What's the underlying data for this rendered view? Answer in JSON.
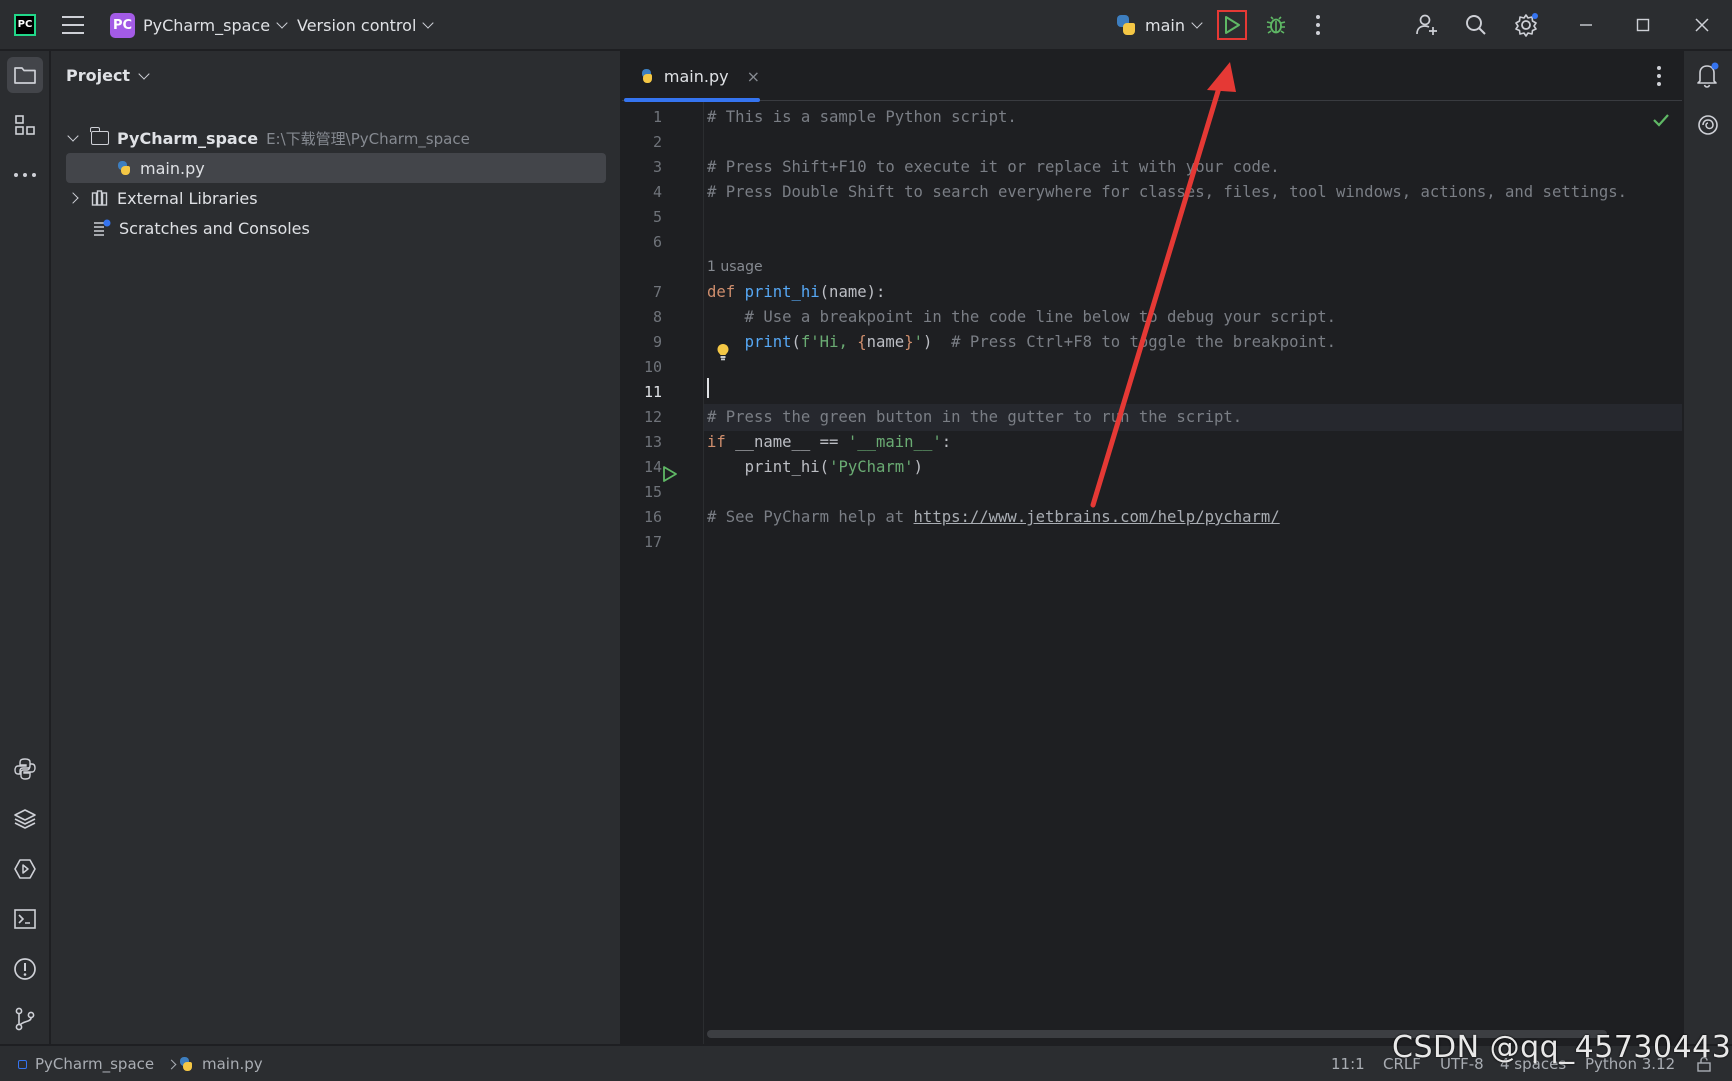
{
  "titlebar": {
    "project_badge": "PC",
    "project_name": "PyCharm_space",
    "version_control": "Version control",
    "run_config": "main"
  },
  "project_panel": {
    "title": "Project",
    "tree": [
      {
        "label": "PyCharm_space",
        "path": "E:\\下载管理\\PyCharm_space",
        "type": "folder",
        "expanded": true
      },
      {
        "label": "main.py",
        "type": "python-file",
        "selected": true
      },
      {
        "label": "External Libraries",
        "type": "library",
        "expanded": false
      },
      {
        "label": "Scratches and Consoles",
        "type": "scratches"
      }
    ]
  },
  "editor": {
    "tab_label": "main.py",
    "tab_close": "×",
    "current_line": 11,
    "usage_hint": "1 usage",
    "line_numbers": [
      "1",
      "2",
      "3",
      "4",
      "5",
      "6",
      "7",
      "8",
      "9",
      "10",
      "11",
      "12",
      "13",
      "14",
      "15",
      "16",
      "17"
    ],
    "lines": {
      "l1": "# This is a sample Python script.",
      "l3": "# Press Shift+F10 to execute it or replace it with your code.",
      "l4": "# Press Double Shift to search everywhere for classes, files, tool windows, actions, and settings.",
      "l7_kw": "def ",
      "l7_fn": "print_hi",
      "l7_rest": "(name):",
      "l8": "    # Use a breakpoint in the code line below to debug your script.",
      "l9_indent": "    ",
      "l9_fn": "print",
      "l9_open": "(",
      "l9_str1": "f'Hi, ",
      "l9_b1": "{",
      "l9_var": "name",
      "l9_b2": "}",
      "l9_str2": "'",
      "l9_close": ")",
      "l9_com": "  # Press Ctrl+F8 to toggle the breakpoint.",
      "l12": "# Press the green button in the gutter to run the script.",
      "l13_kw": "if ",
      "l13_rest": "__name__ == ",
      "l13_str": "'__main__'",
      "l13_colon": ":",
      "l14_indent": "    ",
      "l14_fn": "print_hi",
      "l14_open": "(",
      "l14_str": "'PyCharm'",
      "l14_close": ")",
      "l16_com": "# See PyCharm help at ",
      "l16_link": "https://www.jetbrains.com/help/pycharm/"
    }
  },
  "statusbar": {
    "project": "PyCharm_space",
    "file": "main.py",
    "position": "11:1",
    "line_sep": "CRLF",
    "encoding": "UTF-8",
    "indent": "4 spaces",
    "interpreter": "Python 3.12"
  },
  "watermark": "CSDN @qq_45730443",
  "colors": {
    "accent": "#3574f0",
    "run_green": "#5fb865",
    "annotation_red": "#e53935"
  },
  "icons": [
    "hamburger-menu-icon",
    "run-icon",
    "debug-icon",
    "add-user-icon",
    "search-icon",
    "settings-icon",
    "minimize-icon",
    "maximize-icon",
    "close-icon",
    "folder-icon",
    "structure-icon",
    "more-icon",
    "python-console-icon",
    "layers-icon",
    "services-icon",
    "terminal-icon",
    "problems-icon",
    "git-icon",
    "notifications-icon",
    "ai-assistant-icon"
  ]
}
